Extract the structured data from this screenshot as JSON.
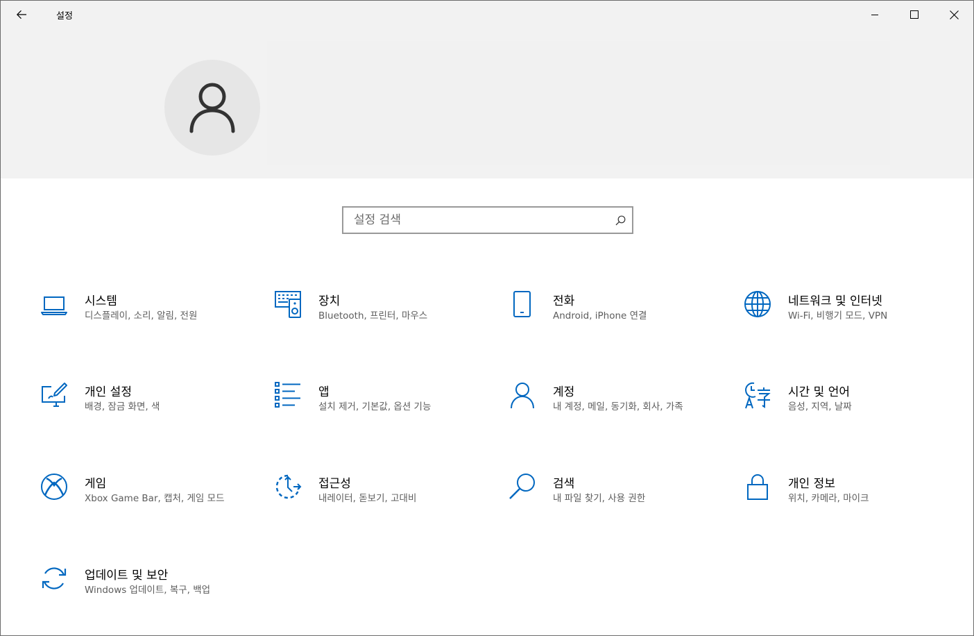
{
  "window": {
    "title": "설정",
    "back_icon": "back-arrow-icon",
    "minimize_icon": "minimize-icon",
    "maximize_icon": "maximize-icon",
    "close_icon": "close-icon"
  },
  "profile": {
    "avatar_icon": "user-avatar-icon"
  },
  "search": {
    "placeholder": "설정 검색",
    "value": "",
    "icon": "search-icon"
  },
  "accent_color": "#0067c0",
  "categories": [
    {
      "id": "system",
      "icon": "laptop-icon",
      "title": "시스템",
      "desc": "디스플레이, 소리, 알림, 전원"
    },
    {
      "id": "devices",
      "icon": "keyboard-speaker-icon",
      "title": "장치",
      "desc": "Bluetooth, 프린터, 마우스"
    },
    {
      "id": "phone",
      "icon": "phone-icon",
      "title": "전화",
      "desc": "Android, iPhone 연결"
    },
    {
      "id": "network",
      "icon": "globe-icon",
      "title": "네트워크 및 인터넷",
      "desc": "Wi-Fi, 비행기 모드, VPN"
    },
    {
      "id": "personalization",
      "icon": "paint-screen-icon",
      "title": "개인 설정",
      "desc": "배경, 잠금 화면, 색"
    },
    {
      "id": "apps",
      "icon": "app-list-icon",
      "title": "앱",
      "desc": "설치 제거, 기본값, 옵션 기능"
    },
    {
      "id": "accounts",
      "icon": "person-icon",
      "title": "계정",
      "desc": "내 계정, 메일, 동기화, 회사, 가족"
    },
    {
      "id": "time-language",
      "icon": "time-language-icon",
      "title": "시간 및 언어",
      "desc": "음성, 지역, 날짜"
    },
    {
      "id": "gaming",
      "icon": "xbox-icon",
      "title": "게임",
      "desc": "Xbox Game Bar, 캡처, 게임 모드"
    },
    {
      "id": "ease-of-access",
      "icon": "ease-of-access-icon",
      "title": "접근성",
      "desc": "내레이터, 돋보기, 고대비"
    },
    {
      "id": "search",
      "icon": "magnifier-icon",
      "title": "검색",
      "desc": "내 파일 찾기, 사용 권한"
    },
    {
      "id": "privacy",
      "icon": "lock-icon",
      "title": "개인 정보",
      "desc": "위치, 카메라, 마이크"
    },
    {
      "id": "update-security",
      "icon": "sync-icon",
      "title": "업데이트 및 보안",
      "desc": "Windows 업데이트, 복구, 백업"
    }
  ]
}
